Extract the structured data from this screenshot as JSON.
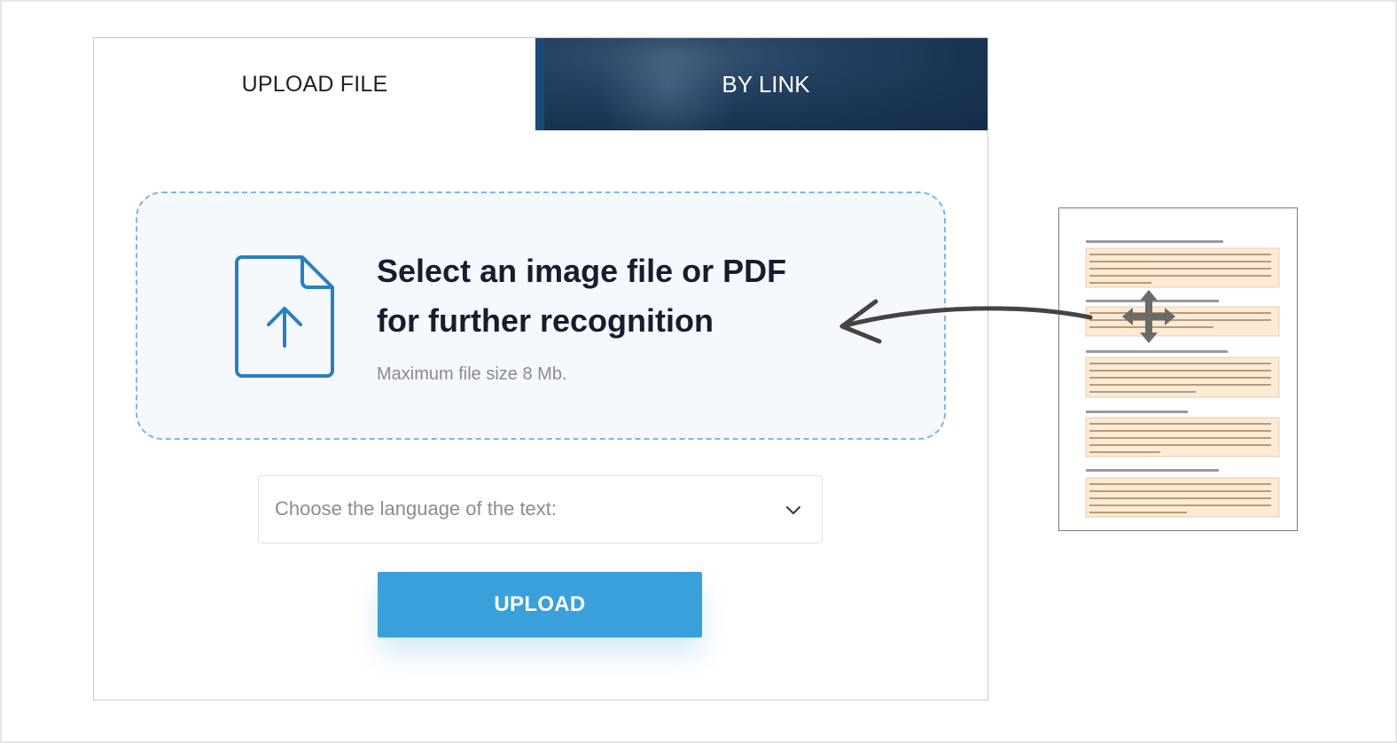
{
  "tabs": {
    "upload_file": "UPLOAD FILE",
    "by_link": "BY LINK"
  },
  "dropzone": {
    "title_line1": "Select an image file or PDF",
    "title_line2": "for further recognition",
    "subtitle": "Maximum file size 8 Mb.",
    "icon": "file-upload-icon"
  },
  "language_select": {
    "placeholder": "Choose the language of the text:",
    "icon": "chevron-down-icon"
  },
  "upload_button": {
    "label": "UPLOAD"
  },
  "overlay": {
    "document_thumbnail": "document-preview",
    "drag_icon": "move-icon",
    "arrow_icon": "curved-arrow-icon"
  },
  "colors": {
    "accent": "#3aa0dc",
    "dropzone_border": "#7fb6de",
    "dropzone_bg": "#f5f9fd",
    "tab_dark": "#1a3554",
    "doc_highlight": "#fdebd6"
  }
}
